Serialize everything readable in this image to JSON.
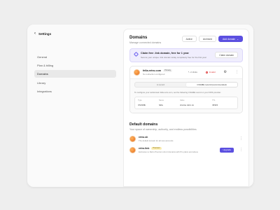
{
  "sidebar": {
    "back_label": "Settings",
    "items": [
      {
        "label": "General"
      },
      {
        "label": "Plan & billing"
      },
      {
        "label": "Domains"
      },
      {
        "label": "Library"
      },
      {
        "label": "Integrations"
      }
    ],
    "active_index": 2
  },
  "header": {
    "title": "Domains",
    "subtitle": "Manage connected domains",
    "active_label": "Active",
    "archived_label": "Archived",
    "add_label": "Add domain"
  },
  "banner": {
    "title": "Claim free .link domain, free for 1 year",
    "description": "Secure your unique .link domain today completely free for the first year",
    "button_label": "Claim domain"
  },
  "domain_card": {
    "name": "fella.retro.com",
    "badge": "Primary",
    "subtitle": "No redirection configured",
    "clicks": "2 clicks",
    "status": "Invalid",
    "tabs": [
      "A record",
      "CNAME record (recommended)"
    ],
    "active_tab": 1,
    "hint": "To configure your subdomain fella.retro.com, set the following CNAME record on your DNS provider.",
    "record": {
      "headers": [
        "Type",
        "Name",
        "Value",
        "TTL"
      ],
      "values": [
        "CNAME",
        "fella",
        "cname.retro.co",
        "43321"
      ]
    }
  },
  "defaults": {
    "title": "Default domains",
    "subtitle": "Your space of ownership, authority, and endless possibilities.",
    "items": [
      {
        "name": "retro.sh",
        "badge": "",
        "description": "The default domain for all new accounts"
      },
      {
        "name": "retro.link",
        "badge": "Premium",
        "description": "Exclusive to Retro Premium short domains with Pro plans and above",
        "button": "Upgrade"
      }
    ]
  },
  "colors": {
    "accent": "#5b4fe0",
    "invalid": "#d33333"
  }
}
